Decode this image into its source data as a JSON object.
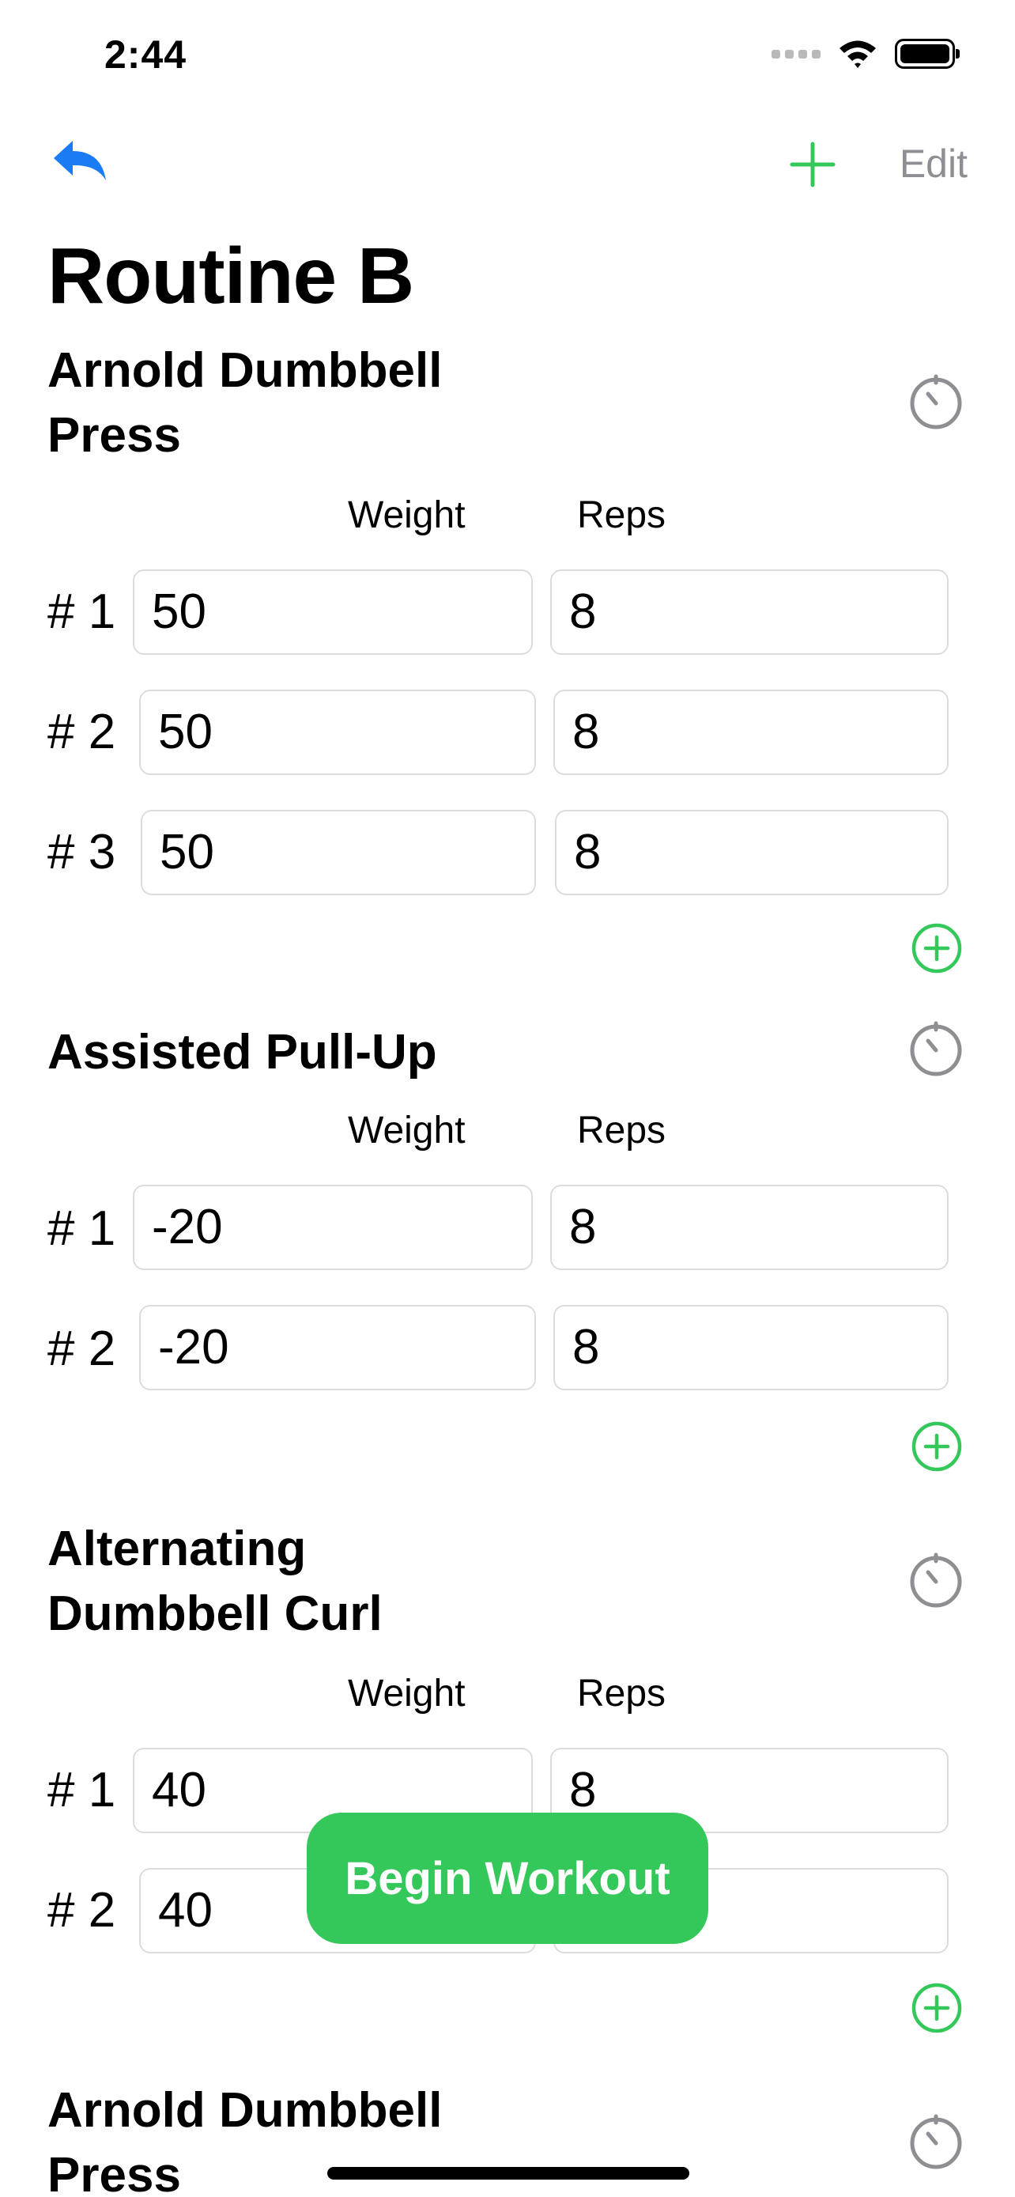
{
  "status_bar": {
    "time": "2:44"
  },
  "nav": {
    "edit_label": "Edit",
    "accent_green": "#34c759",
    "accent_blue": "#1a7cf5"
  },
  "title": "Routine B",
  "columns": {
    "weight": "Weight",
    "reps": "Reps"
  },
  "exercises": [
    {
      "name": "Arnold Dumbbell Press",
      "sets": [
        {
          "label": "# 1",
          "weight": "50",
          "reps": "8"
        },
        {
          "label": "# 2",
          "weight": "50",
          "reps": "8"
        },
        {
          "label": "# 3",
          "weight": "50",
          "reps": "8"
        }
      ]
    },
    {
      "name": "Assisted Pull-Up",
      "sets": [
        {
          "label": "# 1",
          "weight": "-20",
          "reps": "8"
        },
        {
          "label": "# 2",
          "weight": "-20",
          "reps": "8"
        }
      ]
    },
    {
      "name": "Alternating Dumbbell Curl",
      "sets": [
        {
          "label": "# 1",
          "weight": "40",
          "reps": "8"
        },
        {
          "label": "# 2",
          "weight": "40",
          "reps": ""
        }
      ]
    },
    {
      "name": "Arnold Dumbbell Press",
      "sets": []
    }
  ],
  "begin_button": "Begin Workout",
  "icons": {
    "back": "back-arrow-icon",
    "add": "plus-icon",
    "timer": "timer-icon",
    "add_set": "plus-circle-icon",
    "wifi": "wifi-icon",
    "battery": "battery-icon",
    "signal": "signal-icon"
  }
}
